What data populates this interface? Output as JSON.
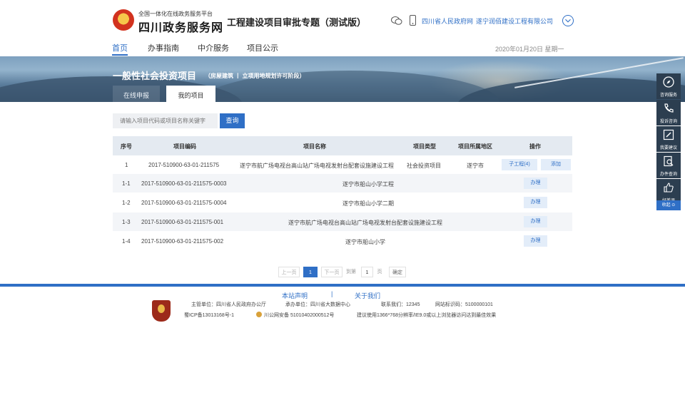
{
  "header": {
    "site_small": "全国一体化在线政务服务平台",
    "site_name": "四川政务服务网",
    "subtitle": "工程建设项目审批专题（测试版）",
    "gov_link": "四川省人民政府网",
    "company_link": "遂宁润佰建设工程有限公司"
  },
  "nav": {
    "items": [
      {
        "label": "首页"
      },
      {
        "label": "办事指南"
      },
      {
        "label": "中介服务"
      },
      {
        "label": "项目公示"
      }
    ],
    "date": "2020年01月20日 星期一"
  },
  "banner": {
    "title": "一般性社会投资项目",
    "tags": "（房屋建筑 丨 立项用地规划许可阶段）",
    "tabs": [
      {
        "label": "在线申报"
      },
      {
        "label": "我的项目"
      }
    ]
  },
  "search": {
    "placeholder": "请输入项目代码或项目名称关键字",
    "button": "查询"
  },
  "table": {
    "headers": [
      "序号",
      "项目编码",
      "项目名称",
      "项目类型",
      "项目所属地区",
      "操作"
    ],
    "rows": [
      {
        "no": "1",
        "code": "2017-510900-63-01-211575",
        "name": "遂宁市航广场电视台高山站广场电视发射台配套设施建设工程",
        "type": "社会投资项目",
        "area": "遂宁市",
        "actions": [
          "子工程(4)",
          "添加"
        ]
      },
      {
        "no": "1-1",
        "code": "2017-510900-63-01-211575-0003",
        "name": "遂宁市船山小学工程",
        "type": "",
        "area": "",
        "actions": [
          "办理"
        ]
      },
      {
        "no": "1-2",
        "code": "2017-510900-63-01-211575-0004",
        "name": "遂宁市船山小学二期",
        "type": "",
        "area": "",
        "actions": [
          "办理"
        ]
      },
      {
        "no": "1-3",
        "code": "2017-510900-63-01-211575-001",
        "name": "遂宁市航广场电视台高山站广场电视发射台配套设施建设工程",
        "type": "",
        "area": "",
        "actions": [
          "办理"
        ]
      },
      {
        "no": "1-4",
        "code": "2017-510900-63-01-211575-002",
        "name": "遂宁市船山小学",
        "type": "",
        "area": "",
        "actions": [
          "办理"
        ]
      }
    ]
  },
  "pager": {
    "prev": "上一页",
    "current": "1",
    "next": "下一页",
    "goto_prefix": "到第",
    "goto_value": "1",
    "goto_suffix": "页",
    "confirm": "确定"
  },
  "footer": {
    "links": [
      "本站声明",
      "关于我们"
    ],
    "separator": "|",
    "host": "主管单位：四川省人民政府办公厅",
    "organizer": "承办单位：四川省大数据中心",
    "hotline": "联系我们：12345",
    "site_id": "网站标识码：5100000101",
    "icp": "蜀ICP备13013168号-1",
    "police": "川公网安备 51010402000512号",
    "browser": "建议使用1366*768分辨率/IE9.0或以上浏览器访问达到最佳效果"
  },
  "side": {
    "items": [
      {
        "label": "咨询服务",
        "icon": "compass-icon"
      },
      {
        "label": "投诉咨询",
        "icon": "phone-icon"
      },
      {
        "label": "我要建议",
        "icon": "edit-icon"
      },
      {
        "label": "办件查询",
        "icon": "search-doc-icon"
      },
      {
        "label": "好差评",
        "icon": "thumb-icon"
      }
    ],
    "fold": "收起 ⊙"
  },
  "colors": {
    "primary": "#2f6fc6",
    "header_bg": "#e4eaf1",
    "side_bg": "#2c3e50"
  }
}
